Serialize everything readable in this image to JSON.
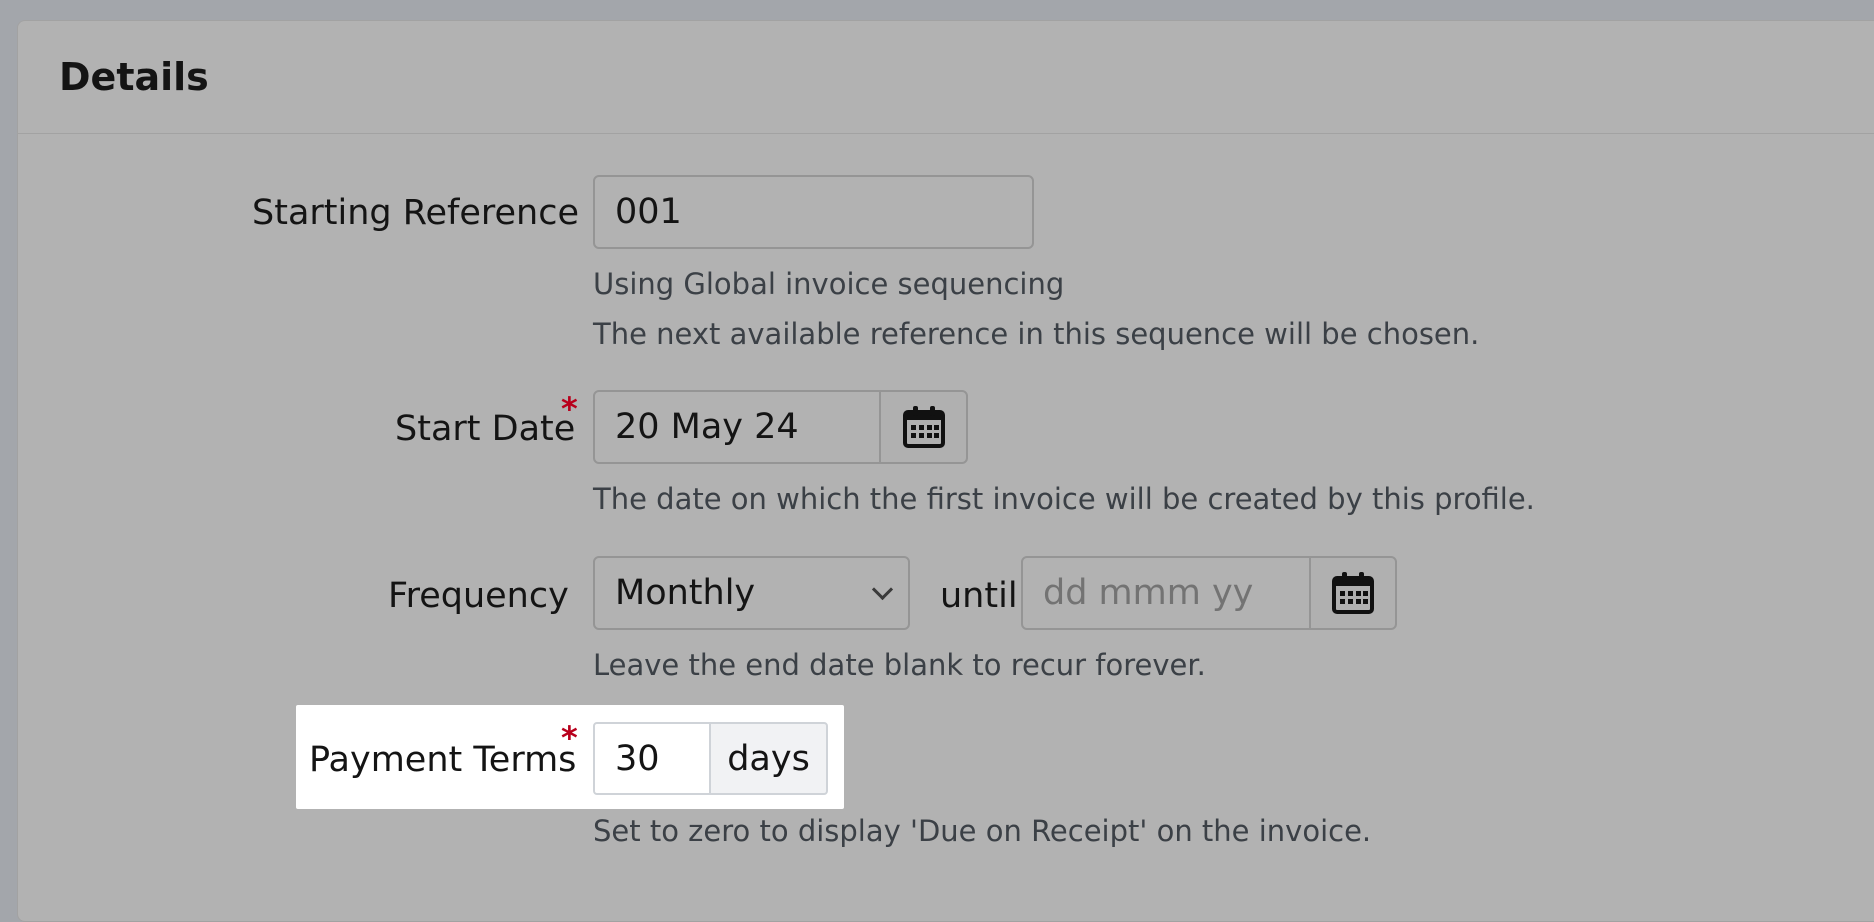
{
  "section_title": "Details",
  "fields": {
    "starting_reference": {
      "label": "Starting Reference",
      "value": "001",
      "help1": "Using Global invoice sequencing",
      "help2": "The next available reference in this sequence will be chosen."
    },
    "start_date": {
      "label": "Start Date",
      "required_mark": "*",
      "value": "20 May 24",
      "icon": "calendar-icon",
      "help": "The date on which the first invoice will be created by this profile."
    },
    "frequency": {
      "label": "Frequency",
      "selected": "Monthly",
      "until_label": "until",
      "end_date_placeholder": "dd mmm yy",
      "icon": "calendar-icon",
      "help": "Leave the end date blank to recur forever."
    },
    "payment_terms": {
      "label": "Payment Terms",
      "required_mark": "*",
      "value": "30",
      "unit": "days",
      "help": "Set to zero to display 'Due on Receipt' on the invoice."
    }
  },
  "colors": {
    "required": "#b8001c",
    "highlight": "#ffffff"
  }
}
